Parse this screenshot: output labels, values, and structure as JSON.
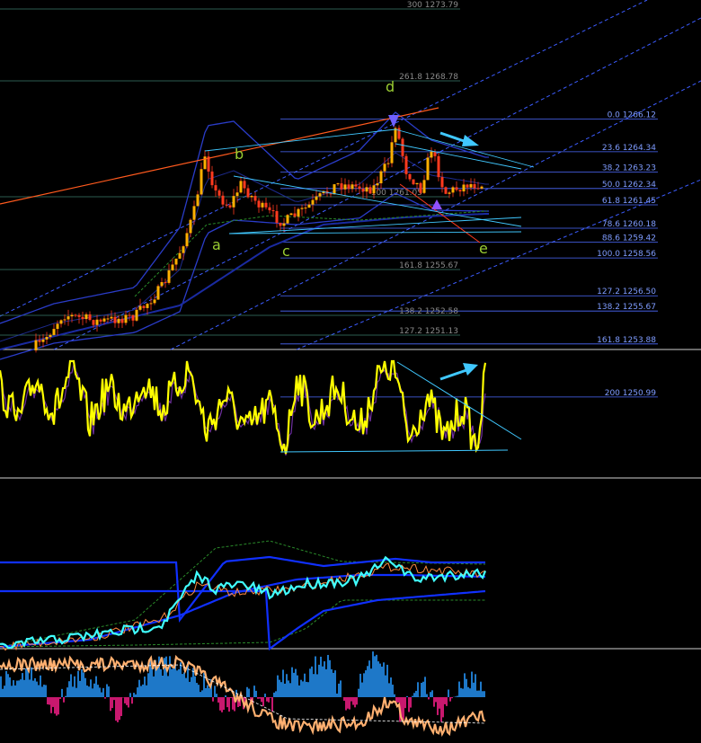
{
  "chart_data": [
    {
      "type": "line",
      "panel": "price",
      "wave_labels": [
        "a",
        "b",
        "c",
        "d",
        "e"
      ],
      "fib_levels_right": [
        {
          "label": "0.0 1266.12",
          "value": 1266.12
        },
        {
          "label": "23.6 1264.34",
          "value": 1264.34
        },
        {
          "label": "38.2 1263.23",
          "value": 1263.23
        },
        {
          "label": "50.0 1262.34",
          "value": 1262.34
        },
        {
          "label": "61.8 1261.45",
          "value": 1261.45
        },
        {
          "label": "78.6 1260.18",
          "value": 1260.18
        },
        {
          "label": "88.6 1259.42",
          "value": 1259.42
        },
        {
          "label": "100.0 1258.56",
          "value": 1258.56
        },
        {
          "label": "127.2 1256.50",
          "value": 1256.5
        },
        {
          "label": "138.2 1255.67",
          "value": 1255.67
        },
        {
          "label": "161.8 1253.88",
          "value": 1253.88
        },
        {
          "label": "200 1250.99",
          "value": 1250.99
        }
      ],
      "fib_levels_mid": [
        {
          "label": "300 1273.79",
          "value": 1273.79
        },
        {
          "label": "261.8 1268.78",
          "value": 1268.78
        },
        {
          "label": "161.8 1255.67",
          "value": 1255.67
        },
        {
          "label": "138.2 1252.58",
          "value": 1252.58
        },
        {
          "label": "127.2 1251.13",
          "value": 1251.13
        },
        {
          "label": "100 1261.05",
          "value": 1261.05
        }
      ],
      "colors": {
        "price_up": "#ff3a1e",
        "price_down": "#ff3a1e",
        "fib": "#4d6bff",
        "trend": "#40c8ff",
        "resistance": "#ff5a1e",
        "wave": "#9acd32"
      }
    },
    {
      "type": "line",
      "panel": "oscillator",
      "colors": {
        "main": "#ffff00",
        "signal": "#7030a0",
        "trend": "#40c8ff"
      }
    },
    {
      "type": "line",
      "panel": "moving-averages",
      "colors": {
        "fast": "#40ffff",
        "slow": "#1030ff",
        "band": "#2a8a2a",
        "orange": "#ff8a40"
      }
    },
    {
      "type": "bar",
      "panel": "histogram",
      "colors": {
        "positive": "#1e78c8",
        "negative": "#c8186e",
        "line": "#ffb070"
      }
    }
  ]
}
